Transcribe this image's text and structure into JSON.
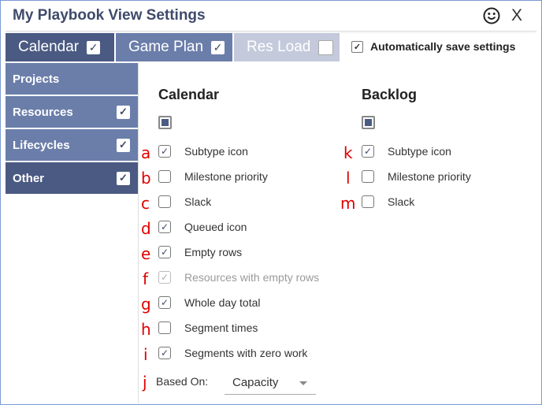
{
  "window": {
    "title": "My Playbook View Settings",
    "feedback_icon": "smiley-icon",
    "close_label": "X"
  },
  "tabs": [
    {
      "label": "Calendar",
      "checked": true,
      "state": "active"
    },
    {
      "label": "Game Plan",
      "checked": true,
      "state": "inactive"
    },
    {
      "label": "Res Load",
      "checked": false,
      "state": "disabled"
    }
  ],
  "autosave": {
    "label": "Automatically save settings",
    "checked": true
  },
  "sidebar": {
    "items": [
      {
        "label": "Projects",
        "has_checkbox": false,
        "checked": false,
        "selected": false
      },
      {
        "label": "Resources",
        "has_checkbox": true,
        "checked": true,
        "selected": false
      },
      {
        "label": "Lifecycles",
        "has_checkbox": true,
        "checked": true,
        "selected": false
      },
      {
        "label": "Other",
        "has_checkbox": true,
        "checked": true,
        "selected": true
      }
    ]
  },
  "calendar": {
    "heading": "Calendar",
    "select_all": "indeterminate",
    "options": [
      {
        "letter": "a",
        "label": "Subtype icon",
        "checked": true,
        "disabled": false
      },
      {
        "letter": "b",
        "label": "Milestone priority",
        "checked": false,
        "disabled": false
      },
      {
        "letter": "c",
        "label": "Slack",
        "checked": false,
        "disabled": false
      },
      {
        "letter": "d",
        "label": "Queued icon",
        "checked": true,
        "disabled": false
      },
      {
        "letter": "e",
        "label": "Empty rows",
        "checked": true,
        "disabled": false
      },
      {
        "letter": "f",
        "label": "Resources with empty rows",
        "checked": true,
        "disabled": true
      },
      {
        "letter": "g",
        "label": "Whole day total",
        "checked": true,
        "disabled": false
      },
      {
        "letter": "h",
        "label": "Segment times",
        "checked": false,
        "disabled": false
      },
      {
        "letter": "i",
        "label": "Segments with zero work",
        "checked": true,
        "disabled": false
      }
    ],
    "based_on": {
      "letter": "j",
      "label": "Based On:",
      "value": "Capacity"
    }
  },
  "backlog": {
    "heading": "Backlog",
    "select_all": "indeterminate",
    "options": [
      {
        "letter": "k",
        "label": "Subtype icon",
        "checked": true,
        "disabled": false
      },
      {
        "letter": "l",
        "label": "Milestone priority",
        "checked": false,
        "disabled": false
      },
      {
        "letter": "m",
        "label": "Slack",
        "checked": false,
        "disabled": false
      }
    ]
  },
  "check_glyph": "✓"
}
